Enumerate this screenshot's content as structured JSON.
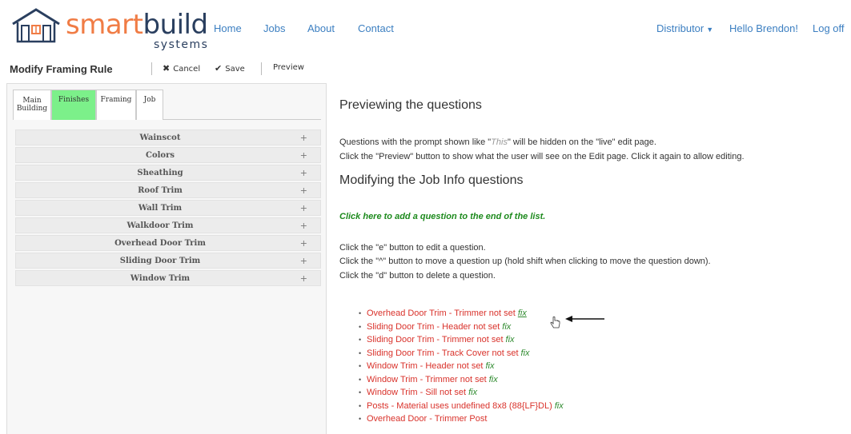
{
  "brand": {
    "word_a": "smart",
    "word_b": "build",
    "sub": "systems"
  },
  "nav": {
    "home": "Home",
    "jobs": "Jobs",
    "about": "About",
    "contact": "Contact",
    "distributor": "Distributor",
    "hello": "Hello Brendon!",
    "logoff": "Log off"
  },
  "toolbar": {
    "title": "Modify Framing Rule",
    "cancel": "Cancel",
    "save": "Save",
    "preview": "Preview"
  },
  "tabs": [
    {
      "line1": "Main",
      "line2": "Building"
    },
    {
      "label": "Finishes"
    },
    {
      "label": "Framing"
    },
    {
      "label": "Job"
    }
  ],
  "accordion": [
    "Wainscot",
    "Colors",
    "Sheathing",
    "Roof Trim",
    "Wall Trim",
    "Walkdoor Trim",
    "Overhead Door Trim",
    "Sliding Door Trim",
    "Window Trim"
  ],
  "content": {
    "h_preview": "Previewing the questions",
    "p1_before": "Questions with the prompt shown like \"",
    "p1_this": "This",
    "p1_after": "\" will be hidden on the \"live\" edit page.",
    "p2": "Click the \"Preview\" button to show what the user will see on the Edit page. Click it again to allow editing.",
    "h_modify": "Modifying the Job Info questions",
    "add_link": "Click here to add a question to the end of the list.",
    "help1": "Click the \"e\" button to edit a question.",
    "help2": "Click the \"^\" button to move a question up (hold shift when clicking to move the question down).",
    "help3": "Click the \"d\" button to delete a question."
  },
  "issues": [
    {
      "text": "Overhead Door Trim - Trimmer not set",
      "fix": "fix"
    },
    {
      "text": "Sliding Door Trim - Header not set",
      "fix": "fix"
    },
    {
      "text": "Sliding Door Trim - Trimmer not set",
      "fix": "fix"
    },
    {
      "text": "Sliding Door Trim - Track Cover not set",
      "fix": "fix"
    },
    {
      "text": "Window Trim - Header not set",
      "fix": "fix"
    },
    {
      "text": "Window Trim - Trimmer not set",
      "fix": "fix"
    },
    {
      "text": "Window Trim - Sill not set",
      "fix": "fix"
    },
    {
      "text": "Posts - Material uses undefined 8x8 (88{LF}DL)",
      "fix": "fix"
    },
    {
      "text": "Overhead Door - Trimmer Post",
      "fix": ""
    }
  ],
  "colors": {
    "brand_orange": "#f07c45",
    "brand_navy": "#2a3f5f",
    "link_blue": "#3c7fc1",
    "active_tab": "#7cf08a",
    "error_red": "#d9322b",
    "fix_green": "#2e8a2e"
  },
  "icons": {
    "logo": "house-logo-icon",
    "cancel": "close-icon",
    "save": "checkmark-icon",
    "accordion": "plus-icon",
    "pointer": "hand-cursor-icon",
    "annotation": "arrow-left-icon"
  }
}
